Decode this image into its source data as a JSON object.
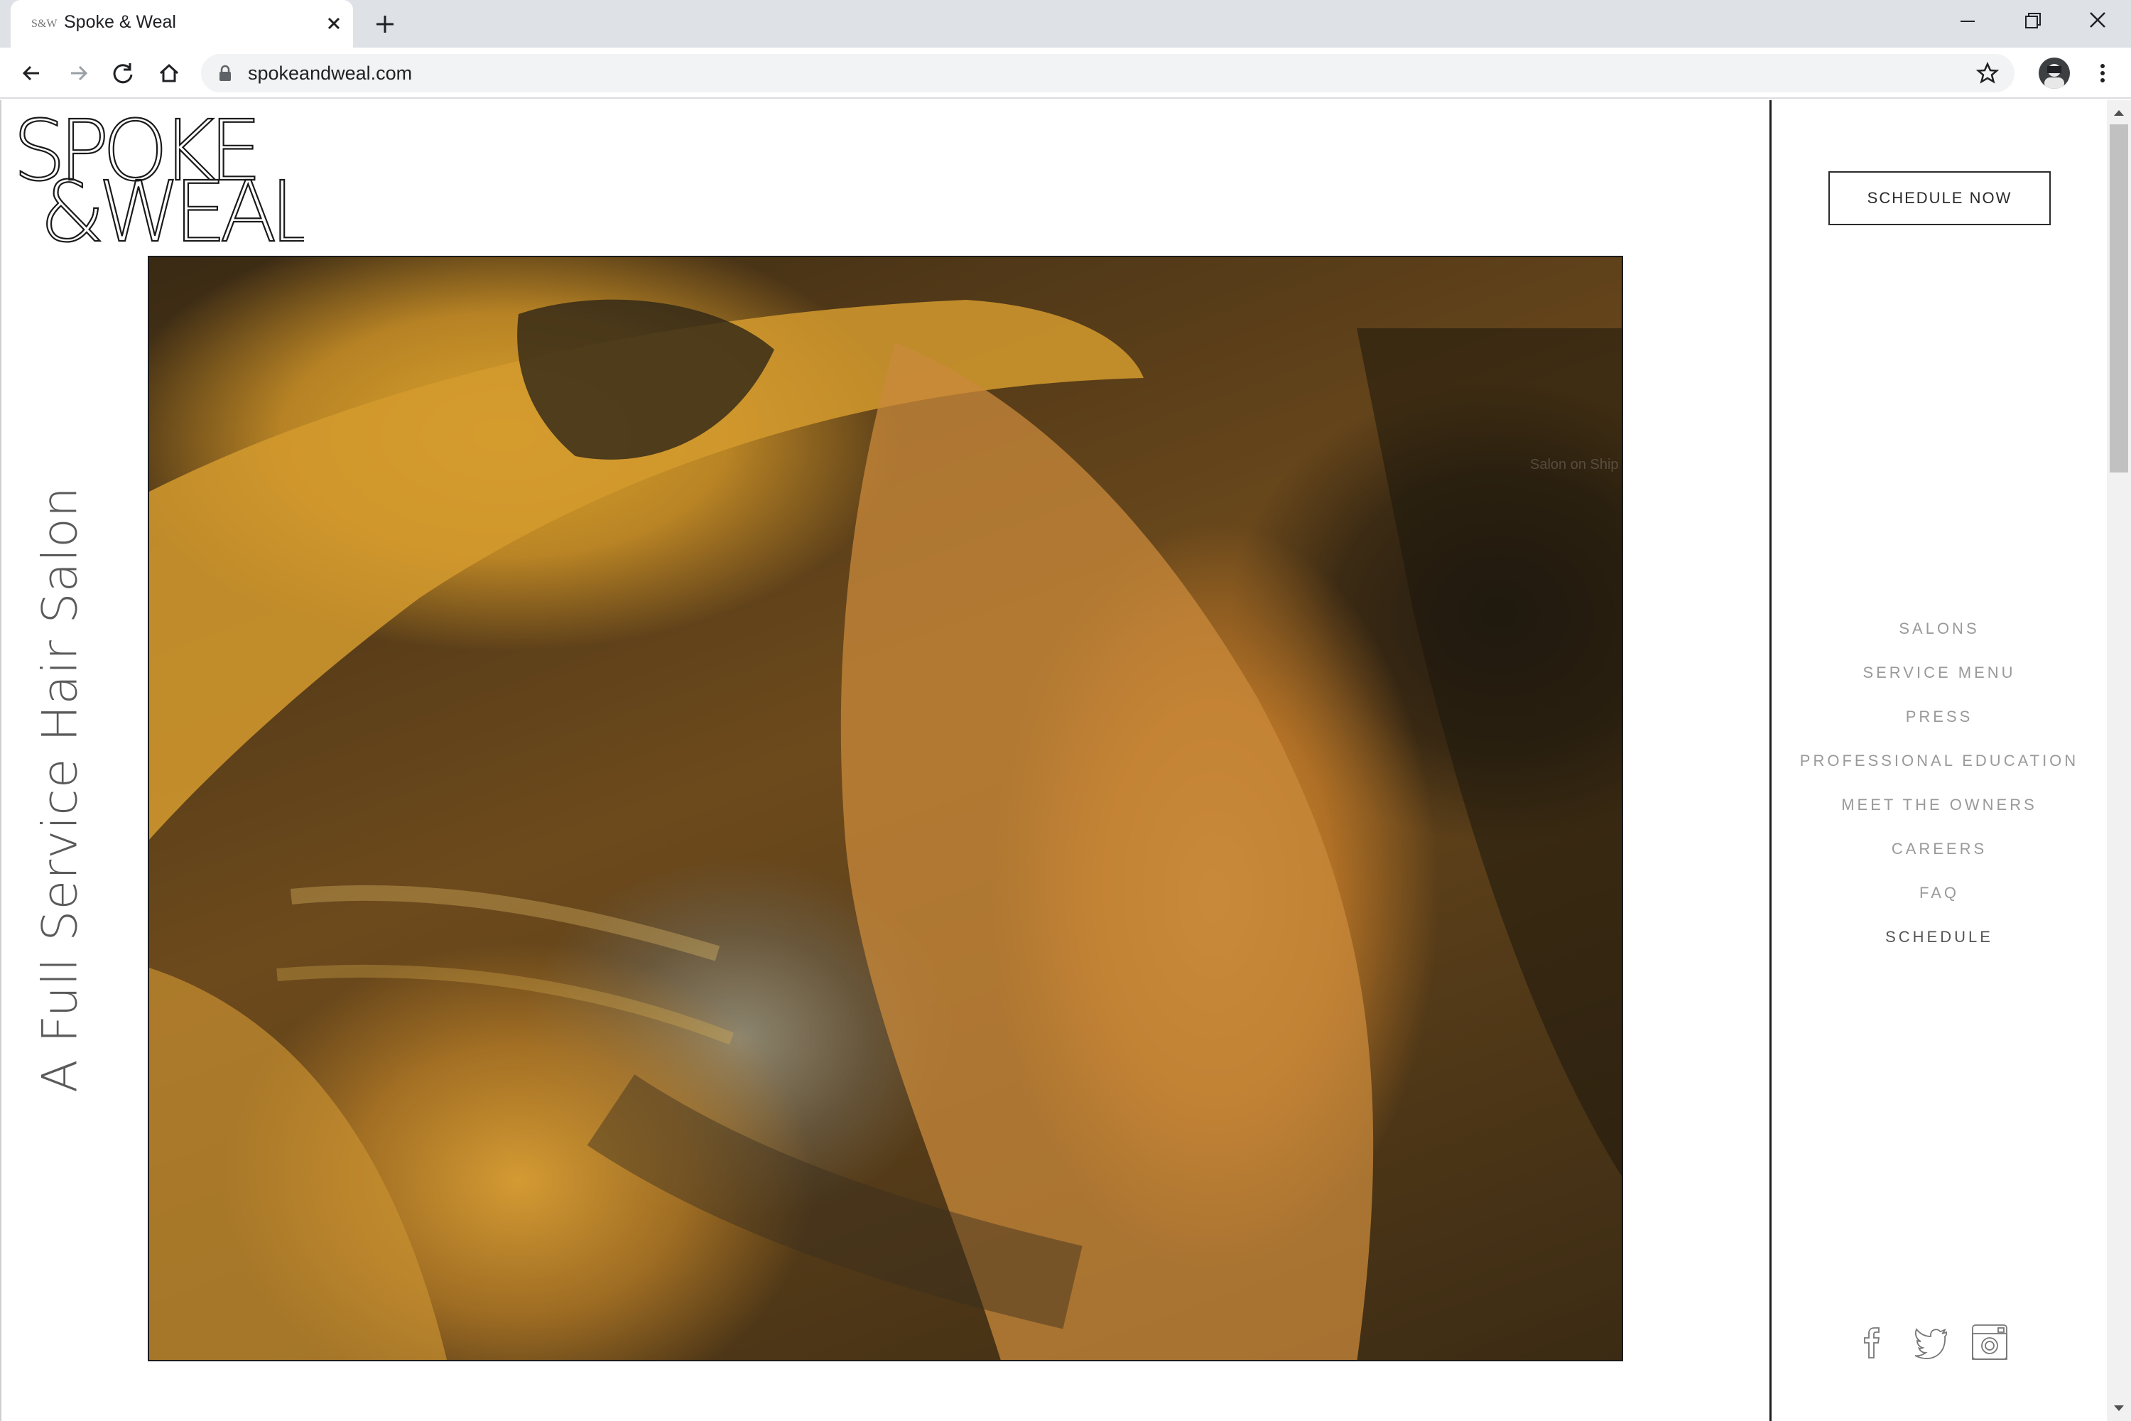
{
  "browser": {
    "tab_title": "Spoke & Weal",
    "url": "spokeandweal.com"
  },
  "page": {
    "logo_line1": "SPOKE",
    "logo_line2": "&WEAL",
    "tagline": "A Full Service Hair Salon",
    "hero_overlay_text": "Salon on Ship",
    "schedule_button": "SCHEDULE NOW",
    "nav": [
      {
        "label": "SALONS"
      },
      {
        "label": "SERVICE MENU"
      },
      {
        "label": "PRESS"
      },
      {
        "label": "PROFESSIONAL EDUCATION"
      },
      {
        "label": "MEET THE OWNERS"
      },
      {
        "label": "CAREERS"
      },
      {
        "label": "FAQ"
      },
      {
        "label": "SCHEDULE"
      }
    ],
    "social": [
      {
        "icon": "facebook-icon"
      },
      {
        "icon": "twitter-icon"
      },
      {
        "icon": "instagram-icon"
      }
    ]
  },
  "colors": {
    "nav_text": "#9a9a9a",
    "nav_active": "#555555",
    "divider": "#1e1e1e"
  }
}
